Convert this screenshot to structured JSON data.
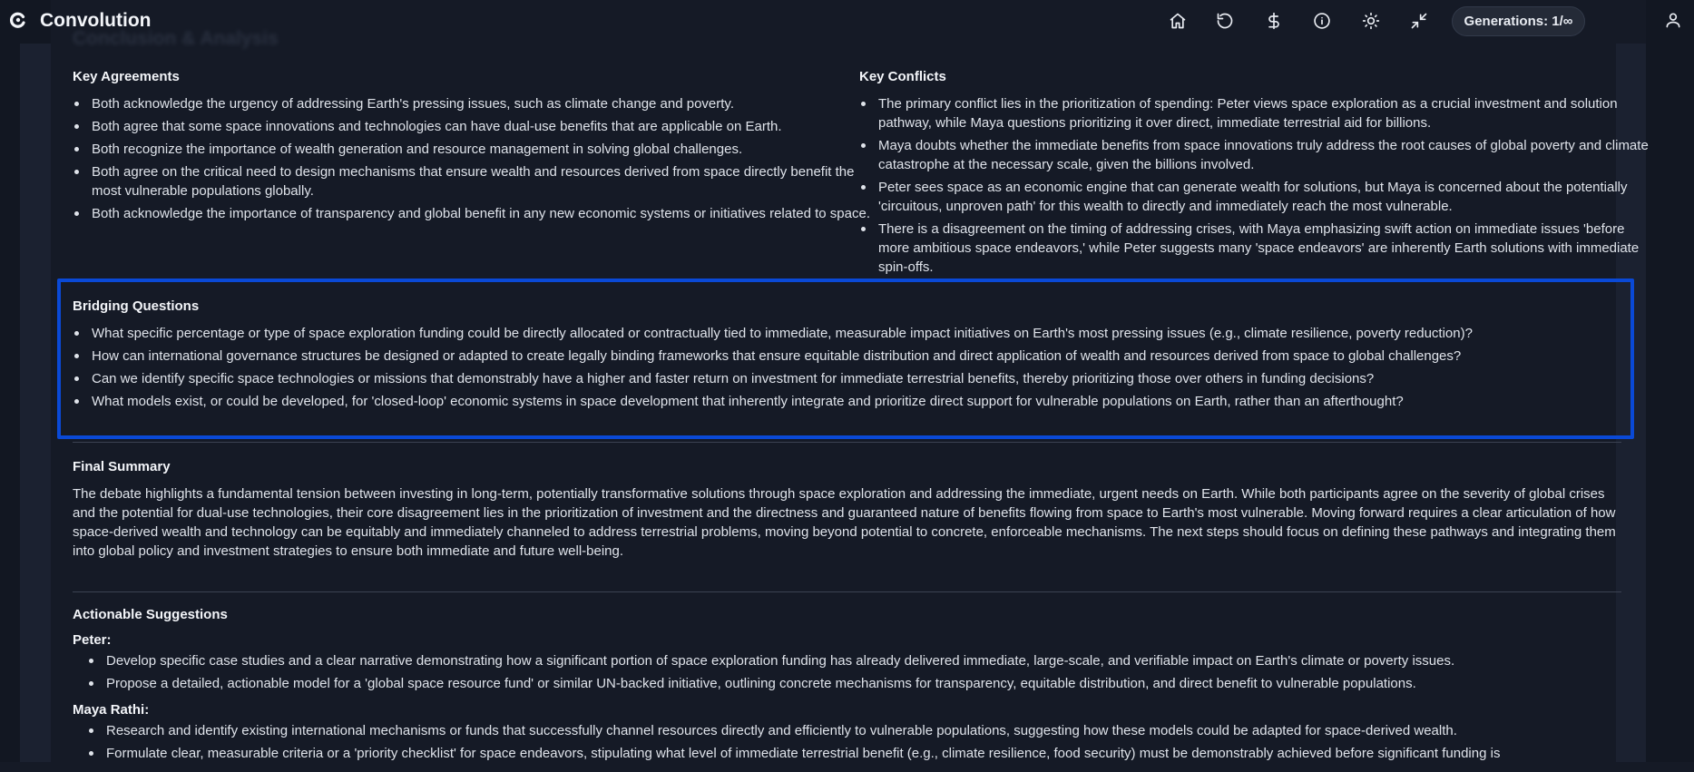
{
  "app": {
    "title": "Convolution",
    "faded_heading": "Conclusion & Analysis"
  },
  "header": {
    "icons": [
      "home-icon",
      "refresh-icon",
      "dollar-icon",
      "info-icon",
      "sun-icon",
      "collapse-icon",
      "user-icon"
    ],
    "generations_label": "Generations: 1/∞"
  },
  "key_agreements": {
    "title": "Key Agreements",
    "items": [
      "Both acknowledge the urgency of addressing Earth's pressing issues, such as climate change and poverty.",
      "Both agree that some space innovations and technologies can have dual-use benefits that are applicable on Earth.",
      "Both recognize the importance of wealth generation and resource management in solving global challenges.",
      "Both agree on the critical need to design mechanisms that ensure wealth and resources derived from space directly benefit the most vulnerable populations globally.",
      "Both acknowledge the importance of transparency and global benefit in any new economic systems or initiatives related to space."
    ]
  },
  "key_conflicts": {
    "title": "Key Conflicts",
    "items": [
      "The primary conflict lies in the prioritization of spending: Peter views space exploration as a crucial investment and solution pathway, while Maya questions prioritizing it over direct, immediate terrestrial aid for billions.",
      "Maya doubts whether the immediate benefits from space innovations truly address the root causes of global poverty and climate catastrophe at the necessary scale, given the billions involved.",
      "Peter sees space as an economic engine that can generate wealth for solutions, but Maya is concerned about the potentially 'circuitous, unproven path' for this wealth to directly and immediately reach the most vulnerable.",
      "There is a disagreement on the timing of addressing crises, with Maya emphasizing swift action on immediate issues 'before more ambitious space endeavors,' while Peter suggests many 'space endeavors' are inherently Earth solutions with immediate spin-offs."
    ]
  },
  "bridging_questions": {
    "title": "Bridging Questions",
    "items": [
      "What specific percentage or type of space exploration funding could be directly allocated or contractually tied to immediate, measurable impact initiatives on Earth's most pressing issues (e.g., climate resilience, poverty reduction)?",
      "How can international governance structures be designed or adapted to create legally binding frameworks that ensure equitable distribution and direct application of wealth and resources derived from space to global challenges?",
      "Can we identify specific space technologies or missions that demonstrably have a higher and faster return on investment for immediate terrestrial benefits, thereby prioritizing those over others in funding decisions?",
      "What models exist, or could be developed, for 'closed-loop' economic systems in space development that inherently integrate and prioritize direct support for vulnerable populations on Earth, rather than an afterthought?"
    ]
  },
  "final_summary": {
    "title": "Final Summary",
    "text": "The debate highlights a fundamental tension between investing in long-term, potentially transformative solutions through space exploration and addressing the immediate, urgent needs on Earth. While both participants agree on the severity of global crises and the potential for dual-use technologies, their core disagreement lies in the prioritization of investment and the directness and guaranteed nature of benefits flowing from space to Earth's most vulnerable. Moving forward requires a clear articulation of how space-derived wealth and technology can be equitably and immediately channeled to address terrestrial problems, moving beyond potential to concrete, enforceable mechanisms. The next steps should focus on defining these pathways and integrating them into global policy and investment strategies to ensure both immediate and future well-being."
  },
  "actionable_suggestions": {
    "title": "Actionable Suggestions",
    "peter": {
      "name": "Peter:",
      "items": [
        "Develop specific case studies and a clear narrative demonstrating how a significant portion of space exploration funding has already delivered immediate, large-scale, and verifiable impact on Earth's climate or poverty issues.",
        "Propose a detailed, actionable model for a 'global space resource fund' or similar UN-backed initiative, outlining concrete mechanisms for transparency, equitable distribution, and direct benefit to vulnerable populations."
      ]
    },
    "maya": {
      "name": "Maya Rathi:",
      "items": [
        "Research and identify existing international mechanisms or funds that successfully channel resources directly and efficiently to vulnerable populations, suggesting how these models could be adapted for space-derived wealth.",
        "Formulate clear, measurable criteria or a 'priority checklist' for space endeavors, stipulating what level of immediate terrestrial benefit (e.g., climate resilience, food security) must be demonstrably achieved before significant funding is"
      ]
    }
  },
  "colors": {
    "background": "#151a26",
    "highlight_border": "#0a49d6",
    "text": "#dfe3ea"
  }
}
